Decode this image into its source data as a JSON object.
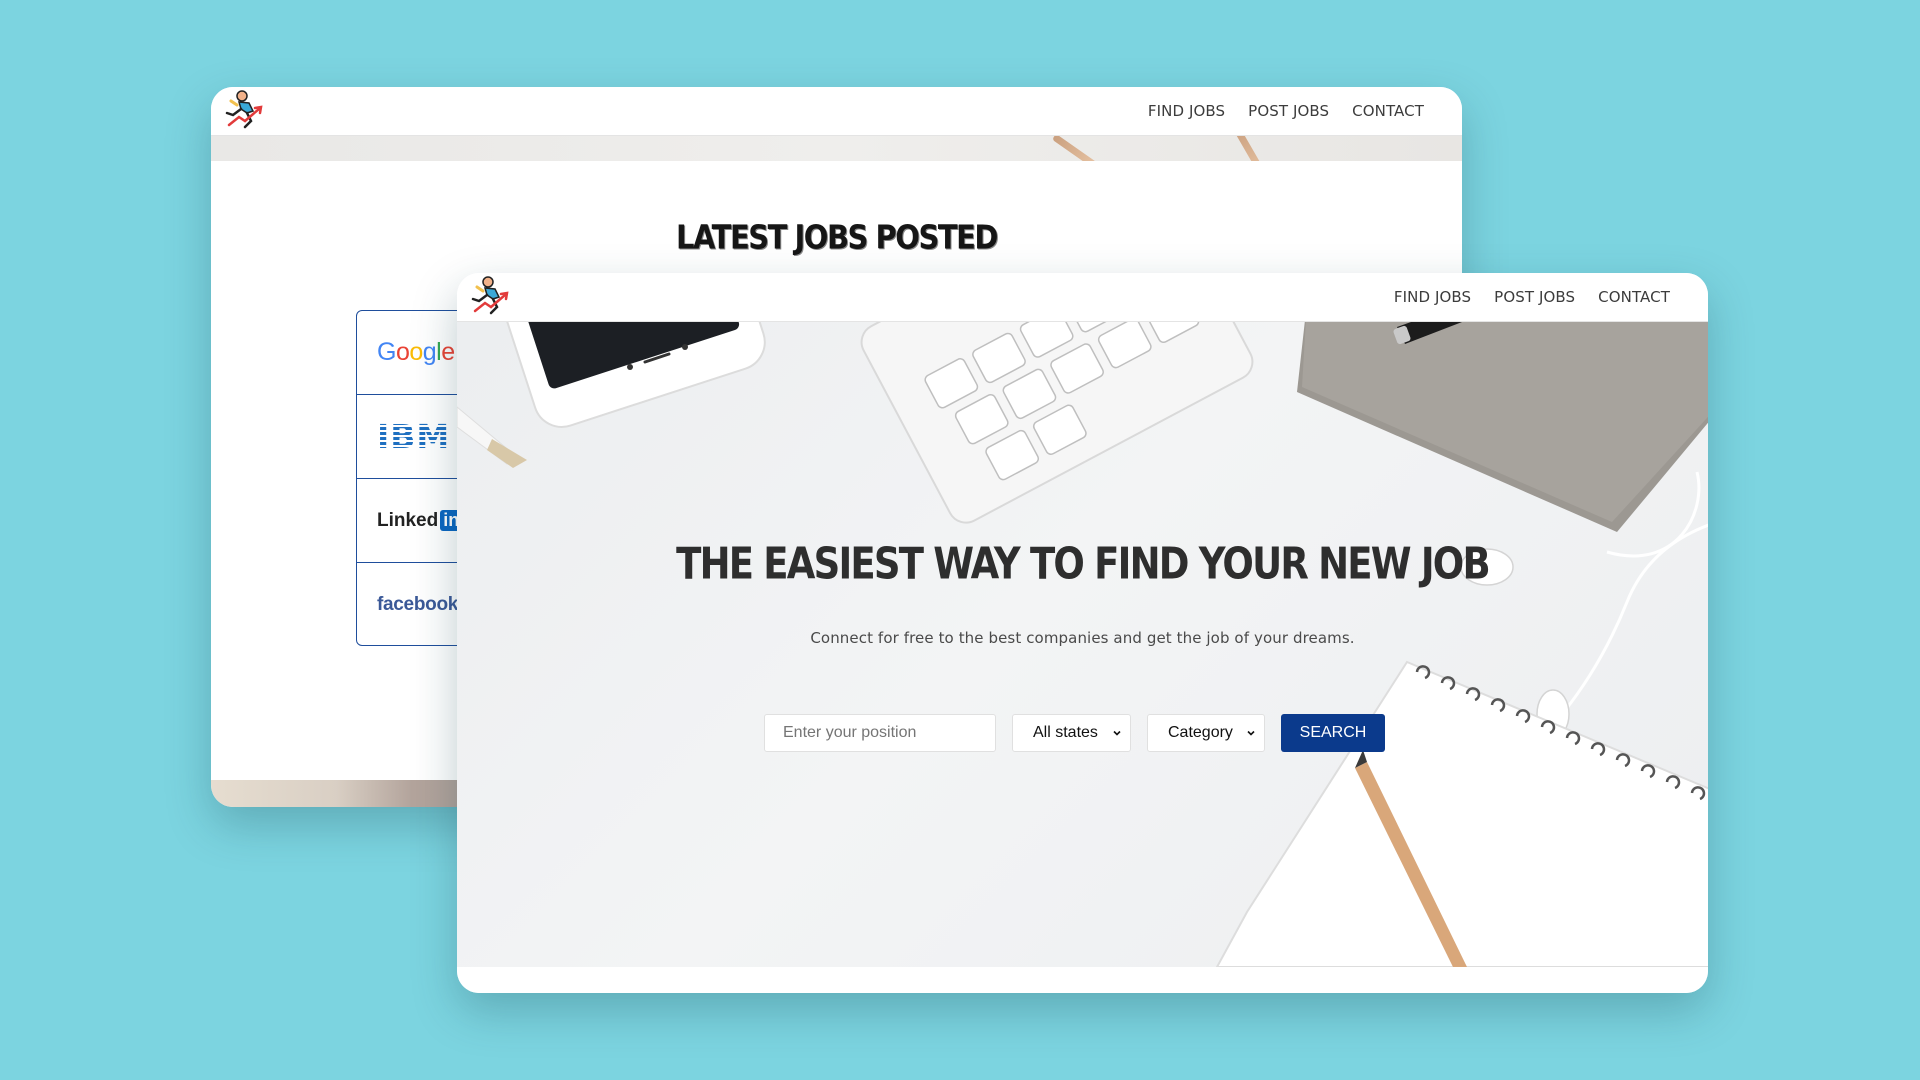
{
  "back_window": {
    "nav": {
      "links": [
        "FIND JOBS",
        "POST JOBS",
        "CONTACT"
      ]
    },
    "section_title": "LATEST JOBS POSTED",
    "companies": {
      "google": "Google",
      "ibm": "IBM",
      "linkedin_text": "Linked",
      "linkedin_box": "in",
      "facebook": "facebook"
    }
  },
  "front_window": {
    "nav": {
      "links": [
        "FIND JOBS",
        "POST JOBS",
        "CONTACT"
      ]
    },
    "hero": {
      "title": "THE EASIEST WAY TO FIND YOUR NEW JOB",
      "subtitle": "Connect for free to the best companies and get the job of your dreams."
    },
    "search": {
      "position_placeholder": "Enter your position",
      "states_selected": "All states",
      "category_selected": "Category",
      "button_label": "SEARCH"
    }
  },
  "colors": {
    "background": "#7cd4e0",
    "search_button": "#0b3a8c",
    "logo_border": "#1f4e9c"
  },
  "icons": [
    "runner-logo-icon",
    "chevron-down-icon"
  ]
}
